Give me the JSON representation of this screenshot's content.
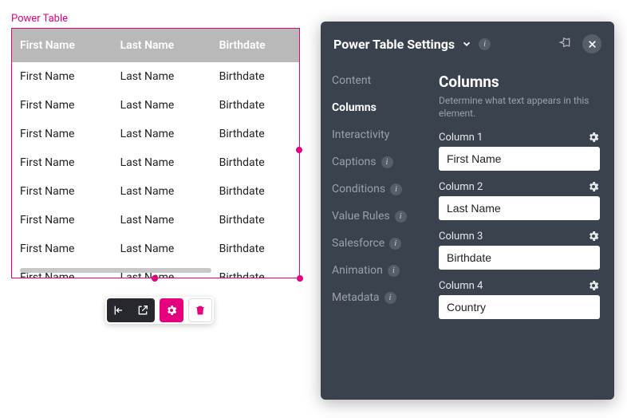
{
  "tableLabel": "Power Table",
  "table": {
    "headers": [
      "First Name",
      "Last Name",
      "Birthdate"
    ],
    "rows": [
      [
        "First Name",
        "Last Name",
        "Birthdate"
      ],
      [
        "First Name",
        "Last Name",
        "Birthdate"
      ],
      [
        "First Name",
        "Last Name",
        "Birthdate"
      ],
      [
        "First Name",
        "Last Name",
        "Birthdate"
      ],
      [
        "First Name",
        "Last Name",
        "Birthdate"
      ],
      [
        "First Name",
        "Last Name",
        "Birthdate"
      ],
      [
        "First Name",
        "Last Name",
        "Birthdate"
      ],
      [
        "First Name",
        "Last Name",
        "Birthdate"
      ]
    ]
  },
  "settings": {
    "title": "Power Table Settings",
    "nav": [
      {
        "label": "Content",
        "info": false
      },
      {
        "label": "Columns",
        "info": false,
        "active": true
      },
      {
        "label": "Interactivity",
        "info": false
      },
      {
        "label": "Captions",
        "info": true
      },
      {
        "label": "Conditions",
        "info": true
      },
      {
        "label": "Value Rules",
        "info": true
      },
      {
        "label": "Salesforce",
        "info": true
      },
      {
        "label": "Animation",
        "info": true
      },
      {
        "label": "Metadata",
        "info": true
      }
    ],
    "columns": {
      "heading": "Columns",
      "sub": "Determine what text appears in this element.",
      "items": [
        {
          "label": "Column 1",
          "value": "First Name"
        },
        {
          "label": "Column 2",
          "value": "Last Name"
        },
        {
          "label": "Column 3",
          "value": "Birthdate"
        },
        {
          "label": "Column 4",
          "value": "Country"
        }
      ]
    }
  }
}
